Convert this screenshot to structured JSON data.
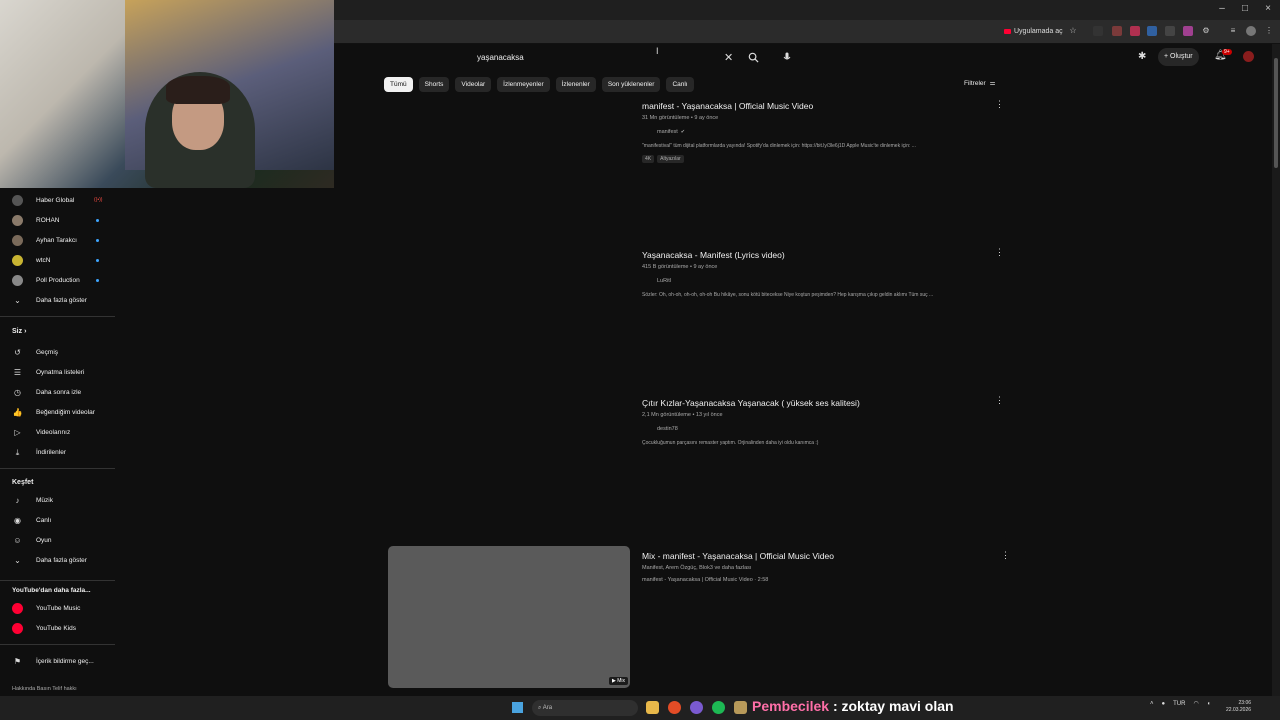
{
  "browser": {
    "open_in_app_label": "Uygulamada aç",
    "min_symbol": "–",
    "max_symbol": "□",
    "close_symbol": "×"
  },
  "header": {
    "search_value": "yaşanacaksa",
    "clear_symbol": "✕",
    "create_label": "Oluştur",
    "notification_count": "9+"
  },
  "chips": [
    {
      "label": "Tümü",
      "active": true
    },
    {
      "label": "Shorts"
    },
    {
      "label": "Videolar"
    },
    {
      "label": "İzlenmeyenler"
    },
    {
      "label": "İzlenenler"
    },
    {
      "label": "Son yüklenenler"
    },
    {
      "label": "Canlı"
    }
  ],
  "filters_label": "Filtreler",
  "results": [
    {
      "title": "manifest - Yaşanacaksa | Official Music Video",
      "meta": "31 Mn görüntüleme • 9 ay önce",
      "channel": "manifest",
      "verified": true,
      "description": "\"manifestival\" tüm dijital platformlarda yayında! Spotify'da dinlemek için: https://bit.ly/3le6j1D Apple Music'te dinlemek için: ...",
      "tags": [
        "4K",
        "Altyazılar"
      ]
    },
    {
      "title": "Yaşanacaksa - Manifest (Lyrics video)",
      "meta": "415 B görüntüleme • 9 ay önce",
      "channel": "LuRitl",
      "description": "Sözler: Oh, oh-oh, oh-oh, oh-oh Bu hikâye, sonu kötü bitecekse Niye koştun peşimden? Hep karışma çıkıp geldin aklımı Tüm suç ..."
    },
    {
      "title": "Çıtır Kızlar-Yaşanacaksa Yaşanacak ( yüksek ses kalitesi)",
      "meta": "2,1 Mn görüntüleme • 13 yıl önce",
      "channel": "destin78",
      "description": "Çocukluğumun parçasını remaster yaptım. Orjinalinden daha iyi oldu kanımca :)"
    },
    {
      "title": "Mix - manifest - Yaşanacaksa | Official Music Video",
      "meta": "Manifest, Arem Özgüç, Blok3 ve daha fazlası",
      "channel": "manifest - Yaşanacaksa | Official Music Video · 2:58",
      "badge": "Mix"
    }
  ],
  "sidebar": {
    "subscriptions": [
      {
        "label": "Haber Global",
        "color": "#555555",
        "live": true
      },
      {
        "label": "ROHAN",
        "color": "#8a7a6a",
        "dot": true
      },
      {
        "label": "Ayhan Tarakcı",
        "color": "#7a6a5a",
        "dot": true
      },
      {
        "label": "wtcN",
        "color": "#c8b432",
        "dot": true
      },
      {
        "label": "Poll Production",
        "color": "#888888",
        "dot": true
      },
      {
        "label": "Daha fazla göster",
        "icon": "⌄"
      }
    ],
    "you_heading": "Siz",
    "you_items": [
      {
        "label": "Geçmiş",
        "icon": "↺"
      },
      {
        "label": "Oynatma listeleri",
        "icon": "☰"
      },
      {
        "label": "Daha sonra izle",
        "icon": "◷"
      },
      {
        "label": "Beğendiğim videolar",
        "icon": "👍"
      },
      {
        "label": "Videolarınız",
        "icon": "▷"
      },
      {
        "label": "İndirilenler",
        "icon": "⤓"
      }
    ],
    "explore_heading": "Keşfet",
    "explore_items": [
      {
        "label": "Müzik",
        "icon": "♪"
      },
      {
        "label": "Canlı",
        "icon": "◉"
      },
      {
        "label": "Oyun",
        "icon": "☺"
      },
      {
        "label": "Daha fazla göster",
        "icon": "⌄"
      }
    ],
    "more_heading": "YouTube'dan daha fazla...",
    "more_items": [
      {
        "label": "YouTube Music",
        "color": "#ff0033"
      },
      {
        "label": "YouTube Kids",
        "color": "#ff0033"
      }
    ],
    "report_label": "İçerik bildirme geç...",
    "footer": "Hakkında   Basın   Telif hakkı"
  },
  "taskbar": {
    "search_placeholder": "Ara",
    "chat_user": "Pembecilek",
    "chat_message": ": zoktay mavi olan",
    "lang": "TUR",
    "time": "23:06",
    "date": "22.03.2026"
  }
}
